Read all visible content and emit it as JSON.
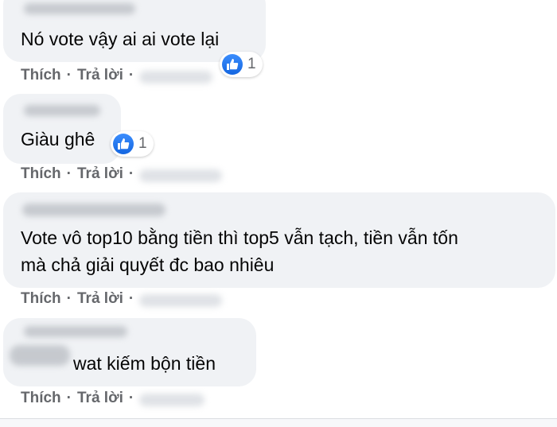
{
  "comments": [
    {
      "text": "Nó vote vậy ai ai vote lại",
      "actions": {
        "like": "Thích",
        "separator": "·",
        "reply": "Trả lời",
        "separator2": "·"
      },
      "reaction": {
        "icon": "like-icon",
        "count": "1"
      }
    },
    {
      "text": "Giàu ghê",
      "actions": {
        "like": "Thích",
        "separator": "·",
        "reply": "Trả lời",
        "separator2": "·"
      },
      "reaction": {
        "icon": "like-icon",
        "count": "1"
      }
    },
    {
      "text_lines": [
        "Vote vô top10 bằng tiền thì top5 vẫn tạch, tiền vẫn tốn",
        "mà chả giải quyết đc bao nhiêu"
      ],
      "actions": {
        "like": "Thích",
        "separator": "·",
        "reply": "Trả lời",
        "separator2": "·"
      }
    },
    {
      "text": "wat kiếm bộn tiền",
      "actions": {
        "like": "Thích",
        "separator": "·",
        "reply": "Trả lời",
        "separator2": "·"
      }
    }
  ],
  "colors": {
    "bubble": "#f0f2f5",
    "action_text": "#65676b",
    "like_blue": "#1877f2"
  }
}
